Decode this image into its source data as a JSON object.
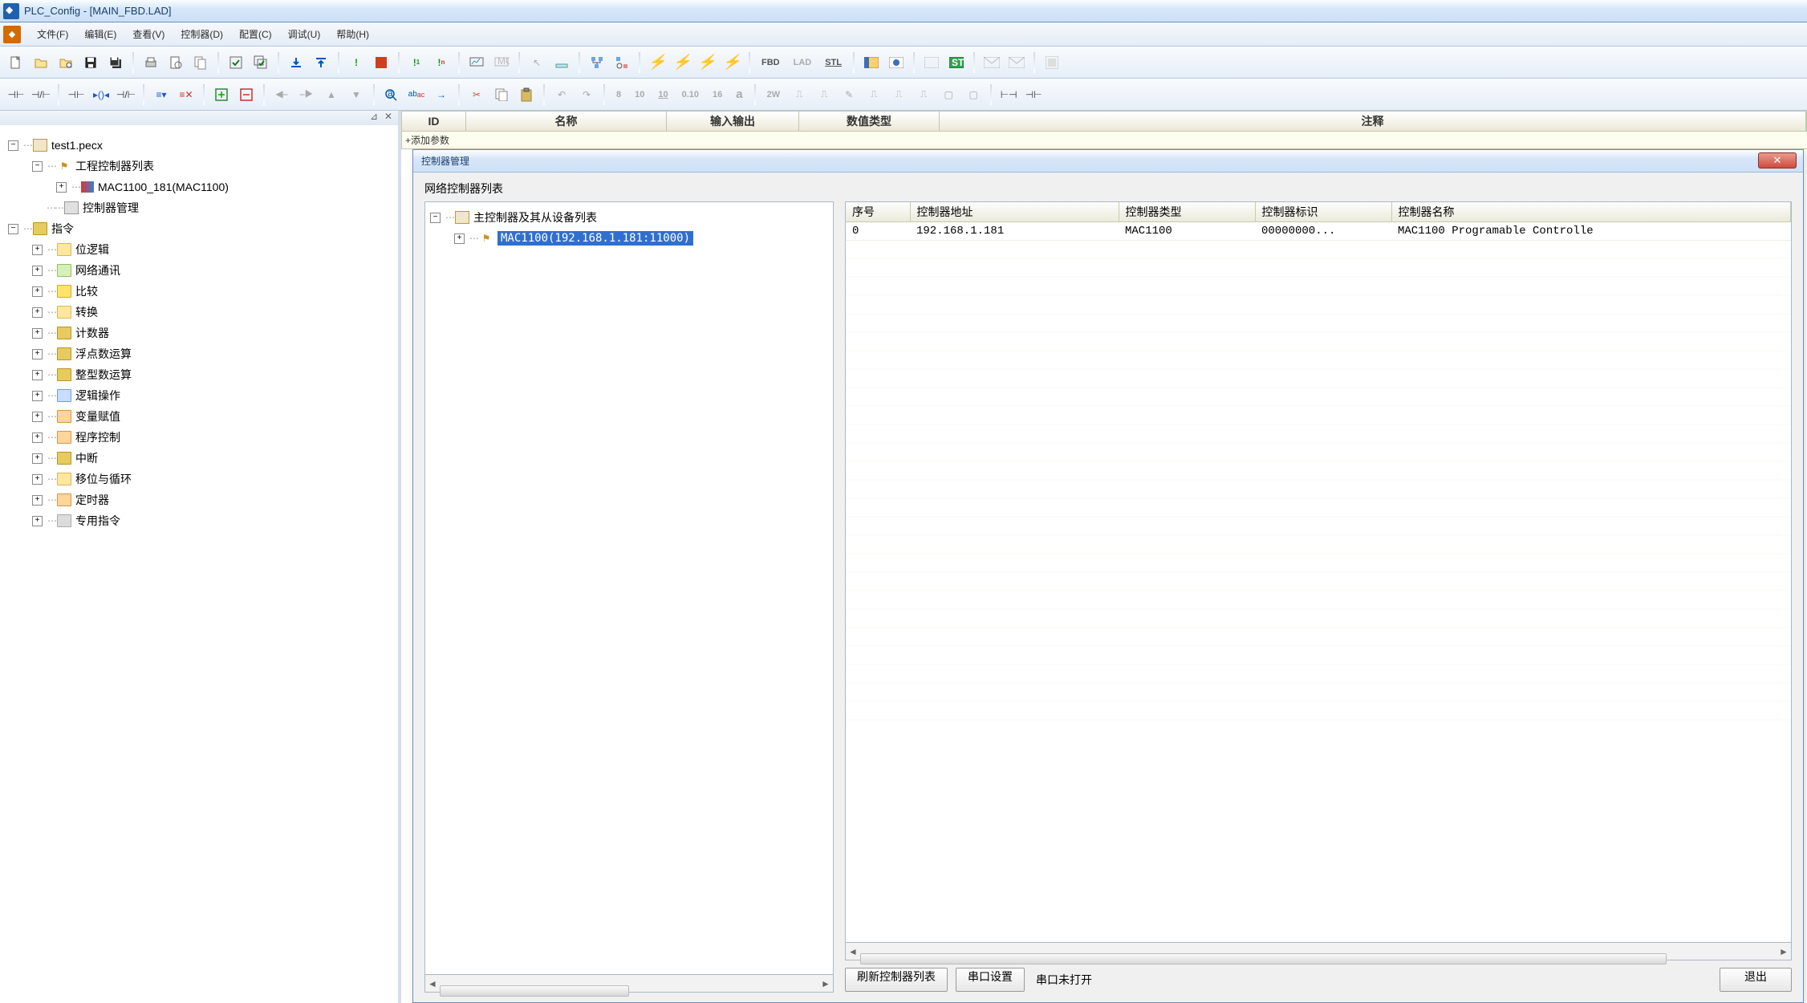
{
  "window": {
    "title": "PLC_Config - [MAIN_FBD.LAD]"
  },
  "menu": {
    "file": "文件(F)",
    "edit": "编辑(E)",
    "view": "查看(V)",
    "controller": "控制器(D)",
    "config": "配置(C)",
    "debug": "调试(U)",
    "help": "帮助(H)"
  },
  "toolbar1": {
    "fbd": "FBD",
    "lad": "LAD",
    "stl": "STL"
  },
  "toolbar2": {
    "labels": [
      "8",
      "10",
      "10",
      "0.10",
      "16",
      "a",
      "2W"
    ]
  },
  "sidebar": {
    "root": "test1.pecx",
    "group1": "工程控制器列表",
    "mac": "MAC1100_181(MAC1100)",
    "controllerMgr": "控制器管理",
    "instructions": "指令",
    "cats": [
      "位逻辑",
      "网络通讯",
      "比较",
      "转换",
      "计数器",
      "浮点数运算",
      "整型数运算",
      "逻辑操作",
      "变量赋值",
      "程序控制",
      "中断",
      "移位与循环",
      "定时器",
      "专用指令"
    ]
  },
  "varheader": {
    "id": "ID",
    "name": "名称",
    "io": "输入输出",
    "type": "数值类型",
    "comment": "注释",
    "addrow": "+添加参数"
  },
  "dialog": {
    "title": "控制器管理",
    "netlist": "网络控制器列表",
    "treeRoot": "主控制器及其从设备列表",
    "treeItem": "MAC1100(192.168.1.181:11000)",
    "cols": {
      "no": "序号",
      "addr": "控制器地址",
      "ctype": "控制器类型",
      "cid": "控制器标识",
      "cname": "控制器名称"
    },
    "row": {
      "no": "0",
      "addr": "192.168.1.181",
      "ctype": "MAC1100",
      "cid": "00000000...",
      "cname": "MAC1100 Programable Controlle"
    },
    "refresh": "刷新控制器列表",
    "serial": "串口设置",
    "serialStatus": "串口未打开",
    "exit": "退出"
  }
}
